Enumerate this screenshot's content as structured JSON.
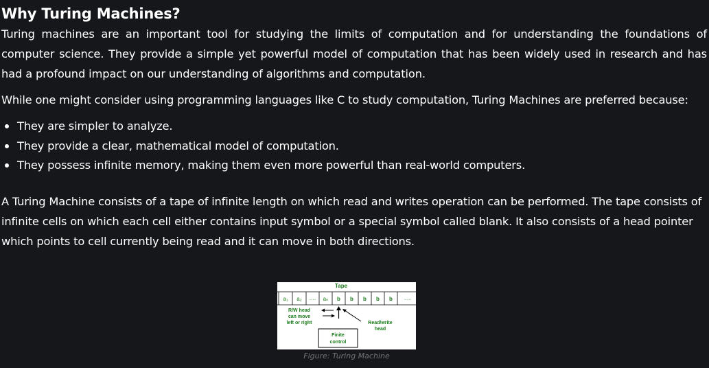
{
  "heading": "Why Turing Machines?",
  "paragraphs": {
    "intro": "Turing machines are an important tool for studying the limits of computation and for understanding the foundations of computer science. They provide a simple yet powerful model of computation that has been widely used in research and has had a profound impact on our understanding of algorithms and computation.",
    "preference": "While one might consider using programming languages like C to study computation, Turing Machines are preferred because:",
    "definition": "A Turing Machine consists of a tape of infinite length on which read and writes operation can be performed. The tape consists of infinite cells on which each cell either contains input symbol or a special symbol called blank. It also consists of a head pointer which points to cell currently being read and it can move in both directions."
  },
  "reasons": [
    "They are simpler to analyze.",
    "They provide a clear, mathematical model of computation.",
    "They possess infinite memory, making them even more powerful than real-world computers."
  ],
  "figure": {
    "caption": "Figure: Turing Machine",
    "tape_label": "Tape",
    "cells": [
      "a₁",
      "a₂",
      "......",
      "aₙ",
      "b",
      "b",
      "b",
      "b",
      "b",
      "......"
    ],
    "rw_head_note": [
      "R/W head",
      "can move",
      "left or right"
    ],
    "head_label": [
      "Read/write",
      "head"
    ],
    "control_label": [
      "Finite",
      "control"
    ],
    "colors": {
      "diagram_text": "#1a7a1a",
      "diagram_bg": "#ffffff",
      "lines": "#000000"
    }
  }
}
